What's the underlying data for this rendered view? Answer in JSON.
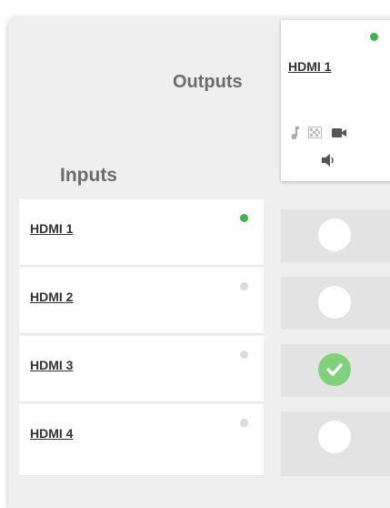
{
  "header": {
    "outputs_label": "Outputs",
    "inputs_label": "Inputs"
  },
  "output": {
    "name": "HDMI 1",
    "status_color": "#3ab54a",
    "icons": [
      "music-icon",
      "video-grid-icon",
      "camera-icon",
      "speaker-icon"
    ]
  },
  "inputs": [
    {
      "name": "HDMI 1",
      "status": "active",
      "status_color": "#3ab54a",
      "routed": false
    },
    {
      "name": "HDMI 2",
      "status": "inactive",
      "status_color": "#dddddd",
      "routed": false
    },
    {
      "name": "HDMI 3",
      "status": "inactive",
      "status_color": "#dddddd",
      "routed": true
    },
    {
      "name": "HDMI 4",
      "status": "inactive",
      "status_color": "#dddddd",
      "routed": false
    }
  ],
  "colors": {
    "accent_green": "#3ab54a",
    "checked_green": "#7ed27a"
  }
}
